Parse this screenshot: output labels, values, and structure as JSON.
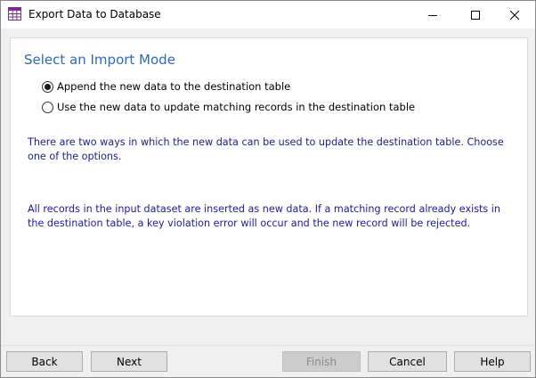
{
  "window": {
    "title": "Export Data to Database",
    "icon": "table-grid-icon",
    "controls": [
      "minimize-icon",
      "maximize-icon",
      "close-icon"
    ]
  },
  "main": {
    "section_title": "Select an Import Mode",
    "options": [
      {
        "label": "Append the new data to the destination table",
        "selected": true
      },
      {
        "label": "Use the new data to update matching records in the destination table",
        "selected": false
      }
    ],
    "description_1": "There are two ways in which the new data can be used to update the destination table. Choose one of the options.",
    "description_2": "All records in the input dataset are inserted as new data. If a matching record already exists in the destination table, a key violation error will occur and the new record will be rejected."
  },
  "footer": {
    "back_label": "Back",
    "next_label": "Next",
    "finish_label": "Finish",
    "cancel_label": "Cancel",
    "help_label": "Help"
  },
  "colors": {
    "section_title": "#2e6bb5",
    "description_text": "#1b1e8c",
    "icon_accent": "#7b2d8e"
  }
}
